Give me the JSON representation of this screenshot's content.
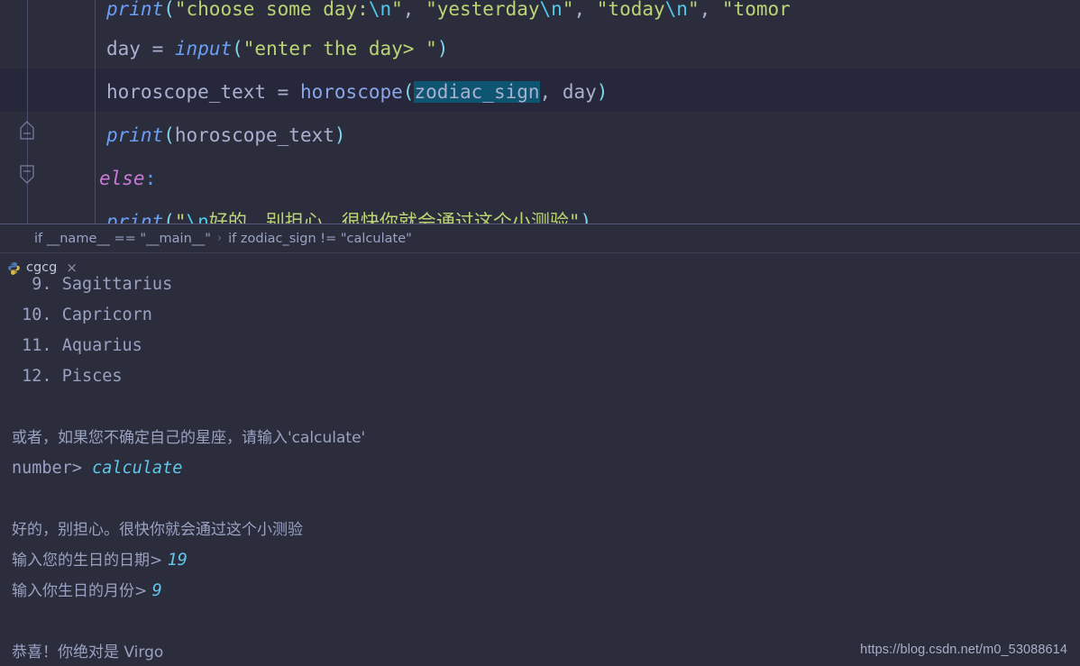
{
  "editor": {
    "lines": [
      {
        "id": "line-print-choose-day",
        "indent": "        ",
        "text": "print(\"choose some day:\\n\", \"yesterday\\n\", \"today\\n\", \"tomor",
        "truncated": true
      },
      {
        "id": "line-day-input",
        "indent": "        ",
        "text": "day = input(\"enter the day> \")"
      },
      {
        "id": "line-horoscope-text",
        "indent": "        ",
        "text": "horoscope_text = horoscope(zodiac_sign, day)",
        "current": true,
        "selection": "zodiac_sign"
      },
      {
        "id": "line-print-horoscope-text",
        "indent": "        ",
        "text": "print(horoscope_text)"
      },
      {
        "id": "line-else",
        "indent": "    ",
        "text": "else:"
      },
      {
        "id": "line-print-encourage",
        "indent": "        ",
        "text": "print(\"\\n好的，别担心。很快你就会通过这个小测验\")",
        "clipped": true
      }
    ],
    "selected_token": "zodiac_sign",
    "current_line_color": "#26273a",
    "selection_color": "#0d5571",
    "squiggle_color": "#c4cf5a"
  },
  "breadcrumb": {
    "items": [
      "if __name__ == \"__main__\"",
      "if zodiac_sign != \"calculate\""
    ],
    "separator": "›"
  },
  "run_tab": {
    "label": "cgcg",
    "close": "×",
    "icon": "python-file-icon",
    "underline_color": "#c248c2"
  },
  "console": {
    "lines": [
      {
        "id": "con-sagittarius",
        "prompt": "  9. Sagittarius",
        "input": "",
        "clipped": true
      },
      {
        "id": "con-capricorn",
        "prompt": " 10. Capricorn",
        "input": ""
      },
      {
        "id": "con-aquarius",
        "prompt": " 11. Aquarius",
        "input": ""
      },
      {
        "id": "con-pisces",
        "prompt": " 12. Pisces",
        "input": ""
      },
      {
        "id": "con-blank-1",
        "prompt": "",
        "input": ""
      },
      {
        "id": "con-or-calculate",
        "prompt": "或者，如果您不确定自己的星座，请输入'calculate'",
        "input": "",
        "cjk": true
      },
      {
        "id": "con-number",
        "prompt": "number> ",
        "input": "calculate"
      },
      {
        "id": "con-blank-2",
        "prompt": "",
        "input": ""
      },
      {
        "id": "con-dont-worry",
        "prompt": "好的，别担心。很快你就会通过这个小测验",
        "input": "",
        "cjk": true
      },
      {
        "id": "con-birth-day",
        "prompt": "输入您的生日的日期> ",
        "input": "19",
        "cjk": true
      },
      {
        "id": "con-birth-month",
        "prompt": "输入你生日的月份> ",
        "input": "9",
        "cjk": true
      },
      {
        "id": "con-blank-3",
        "prompt": "",
        "input": ""
      },
      {
        "id": "con-result",
        "prompt": "恭喜！你绝对是 Virgo",
        "input": "",
        "cjk": true
      }
    ]
  },
  "watermark": {
    "url": "https://blog.csdn.net/m0_53088614"
  },
  "colors": {
    "background": "#2b2d3d",
    "text": "#9aa2c2",
    "string": "#bcd474",
    "function": "#6a9ff5",
    "keyword": "#cb78d8",
    "escape": "#4ec9e8",
    "input_echo": "#5fc7e8"
  }
}
